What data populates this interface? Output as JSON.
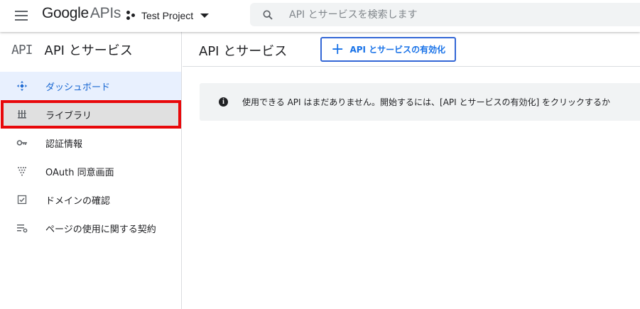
{
  "header": {
    "logo_google": "Google",
    "logo_apis": "APIs",
    "project_name": "Test Project",
    "search_placeholder": "API とサービスを検索します"
  },
  "sidebar": {
    "logo": "API",
    "title": "API とサービス",
    "items": [
      {
        "label": "ダッシュボード",
        "icon": "dashboard-icon",
        "active": true
      },
      {
        "label": "ライブラリ",
        "icon": "library-icon",
        "highlighted": true
      },
      {
        "label": "認証情報",
        "icon": "key-icon"
      },
      {
        "label": "OAuth 同意画面",
        "icon": "oauth-consent-icon"
      },
      {
        "label": "ドメインの確認",
        "icon": "domain-verification-icon"
      },
      {
        "label": "ページの使用に関する契約",
        "icon": "agreement-icon"
      }
    ]
  },
  "main": {
    "title": "API とサービス",
    "enable_button_label": "API とサービスの有効化",
    "notice_text": "使用できる API はまだありません。開始するには、[API とサービスの有効化] をクリックするか"
  },
  "colors": {
    "accent": "#1a73e8",
    "highlight_border": "#e8080a",
    "active_bg": "#e8f0fe"
  }
}
